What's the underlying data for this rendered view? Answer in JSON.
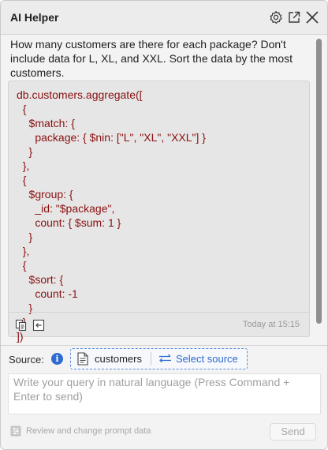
{
  "header": {
    "title": "AI Helper",
    "icons": [
      "gear-icon",
      "external-link-icon",
      "close-icon"
    ]
  },
  "conversation": {
    "question": "How many customers are there for each package? Don't include data for L, XL, and XXL. Sort the data by the most customers.",
    "code": "db.customers.aggregate([\n  {\n    $match: {\n      package: { $nin: [\"L\", \"XL\", \"XXL\"] }\n    }\n  },\n  {\n    $group: {\n      _id: \"$package\",\n      count: { $sum: 1 }\n    }\n  },\n  {\n    $sort: {\n      count: -1\n    }\n  }\n])",
    "timestamp": "Today at 15:15",
    "footer_icons": [
      "copy-icon",
      "insert-icon"
    ]
  },
  "source": {
    "label": "Source:",
    "info": "i",
    "current": "customers",
    "select_label": "Select source"
  },
  "input": {
    "placeholder": "Write your query in natural language (Press Command + Enter to send)"
  },
  "footer": {
    "prompt_link": "Review and change prompt data",
    "send_label": "Send"
  },
  "colors": {
    "code": "#8a1010",
    "accent": "#2d6ad1",
    "panel_bg": "#f3f3f3"
  }
}
